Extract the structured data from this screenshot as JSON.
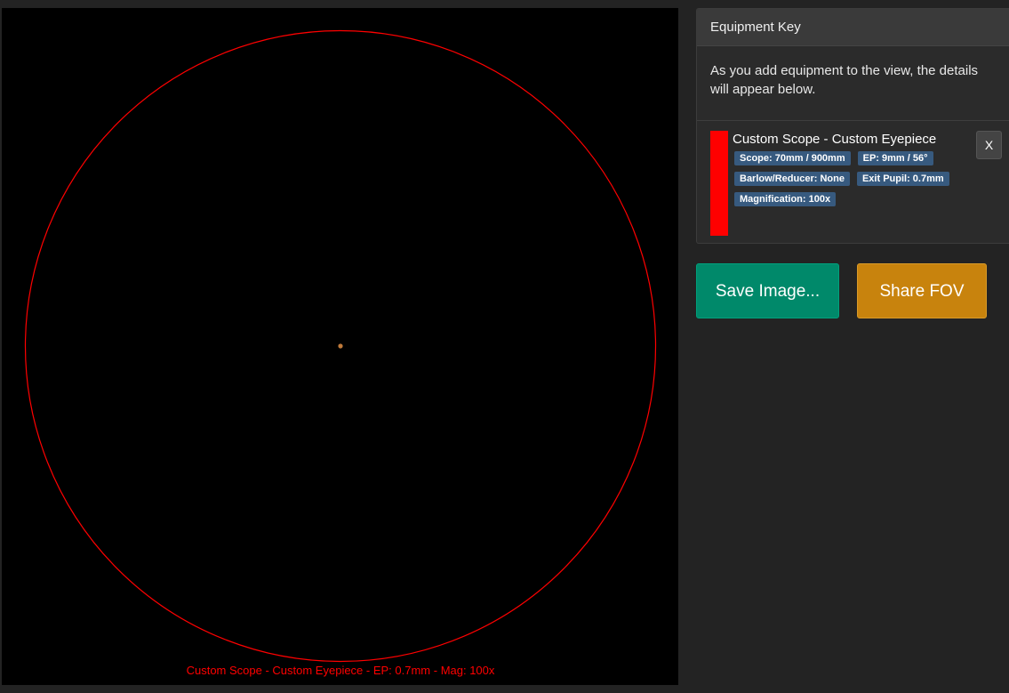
{
  "fov_view": {
    "caption": "Custom Scope - Custom Eyepiece - EP: 0.7mm - Mag: 100x",
    "circle_color": "#ff0000",
    "object_color": "#c07a3a",
    "background_color": "#000000"
  },
  "equipment_key": {
    "title": "Equipment Key",
    "intro": "As you add equipment to the view, the details will appear below.",
    "items": [
      {
        "color": "#ff0000",
        "name": "Custom Scope - Custom Eyepiece",
        "badges": [
          "Scope: 70mm / 900mm",
          "EP: 9mm / 56°",
          "Barlow/Reducer: None",
          "Exit Pupil: 0.7mm",
          "Magnification: 100x"
        ],
        "remove_label": "X"
      }
    ]
  },
  "actions": {
    "save_label": "Save Image...",
    "share_label": "Share FOV",
    "save_color": "#00896a",
    "share_color": "#c8830d"
  }
}
